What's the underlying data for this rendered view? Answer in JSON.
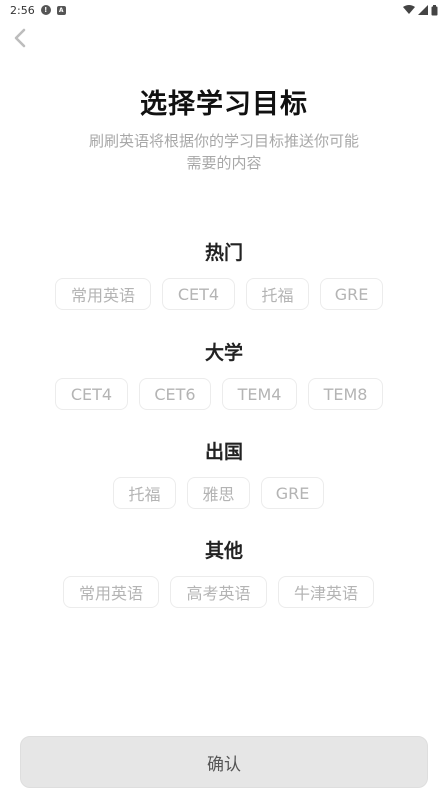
{
  "status_bar": {
    "time": "2:56"
  },
  "header": {
    "title": "选择学习目标",
    "subtitle_line1": "刷刷英语将根据你的学习目标推送你可能",
    "subtitle_line2": "需要的内容"
  },
  "sections": [
    {
      "title": "热门",
      "chips": [
        "常用英语",
        "CET4",
        "托福",
        "GRE"
      ]
    },
    {
      "title": "大学",
      "chips": [
        "CET4",
        "CET6",
        "TEM4",
        "TEM8"
      ]
    },
    {
      "title": "出国",
      "chips": [
        "托福",
        "雅思",
        "GRE"
      ]
    },
    {
      "title": "其他",
      "chips": [
        "常用英语",
        "高考英语",
        "牛津英语"
      ]
    }
  ],
  "confirm_label": "确认",
  "colors": {
    "chip_text": "#b4b4b4",
    "chip_border": "#ececec",
    "button_bg": "#e6e6e6"
  }
}
